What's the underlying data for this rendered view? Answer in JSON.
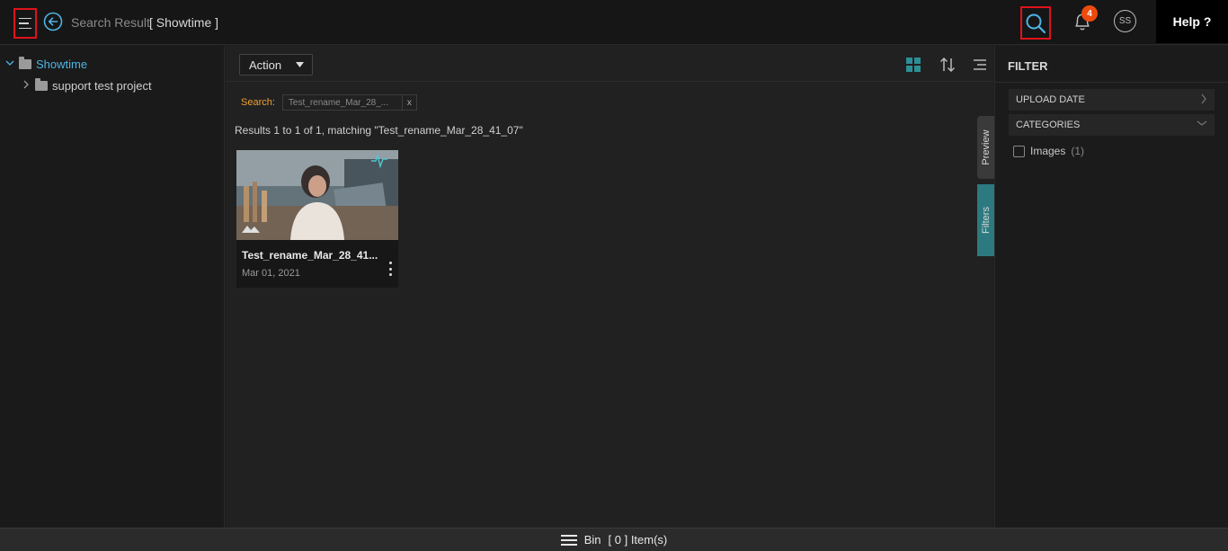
{
  "header": {
    "breadcrumb": "Search Result",
    "current": "[ Showtime ]",
    "notification_count": "4",
    "avatar_initials": "SS",
    "help_label": "Help ?",
    "accent_color": "#4eb4e4"
  },
  "tree": {
    "root": "Showtime",
    "children": [
      "support test project"
    ]
  },
  "toolbar": {
    "action_label": "Action"
  },
  "search": {
    "label": "Search:",
    "chip_text": "Test_rename_Mar_28_...",
    "chip_close": "x"
  },
  "results": {
    "summary": "Results 1 to 1 of 1, matching \"Test_rename_Mar_28_41_07\""
  },
  "card": {
    "title": "Test_rename_Mar_28_41...",
    "date": "Mar 01, 2021"
  },
  "side_tabs": {
    "preview": "Preview",
    "filters": "Filters"
  },
  "filter_panel": {
    "title": "FILTER",
    "upload_date": "UPLOAD DATE",
    "categories": "CATEGORIES",
    "category_items": [
      {
        "label": "Images",
        "count": "(1)"
      }
    ]
  },
  "bottom": {
    "bin_label": "Bin",
    "items_label": "[ 0 ] Item(s)"
  }
}
